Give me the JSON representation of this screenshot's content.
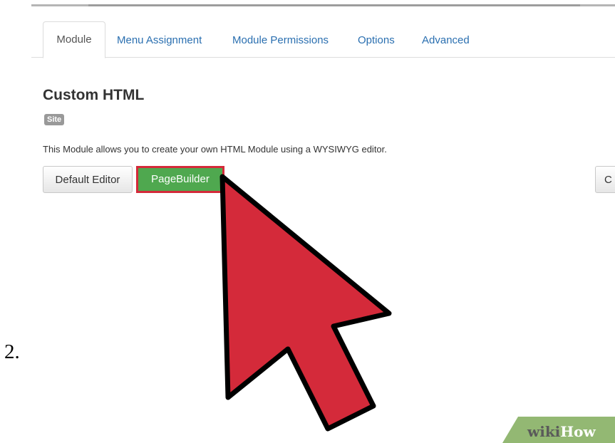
{
  "step": {
    "number": "2."
  },
  "tabs": [
    {
      "label": "Module",
      "active": true
    },
    {
      "label": "Menu Assignment",
      "active": false
    },
    {
      "label": "Module Permissions",
      "active": false
    },
    {
      "label": "Options",
      "active": false
    },
    {
      "label": "Advanced",
      "active": false
    }
  ],
  "module": {
    "title": "Custom HTML",
    "badge": "Site",
    "description": "This Module allows you to create your own HTML Module using a WYSIWYG editor."
  },
  "buttons": {
    "default_editor": "Default Editor",
    "pagebuilder": "PageBuilder",
    "close_partial": "C"
  },
  "watermark": {
    "wiki": "wiki",
    "how": "How"
  },
  "colors": {
    "arrow": "#d42a3a",
    "pagebuilder_bg": "#4fa84f",
    "tab_link": "#2a6fb0"
  },
  "icons": {
    "pointer": "pointer-arrow-icon"
  }
}
